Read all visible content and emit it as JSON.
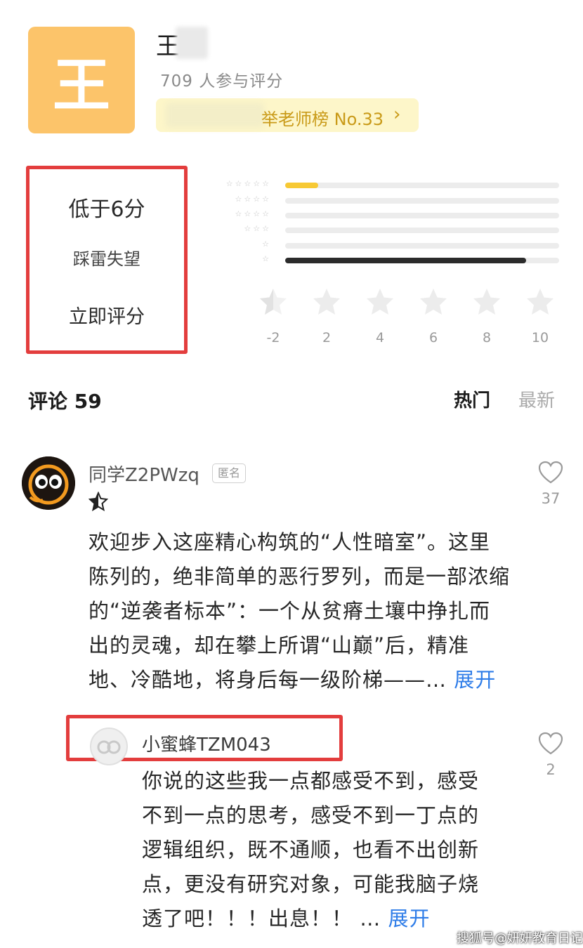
{
  "teacher": {
    "avatar_char": "王",
    "name": "王",
    "participants": "709 人参与评分",
    "rank_text": "举老师榜 No.33",
    "rank_arrow": "›"
  },
  "rating_box": {
    "score": "低于6分",
    "description": "踩雷失望",
    "action": "立即评分"
  },
  "distribution": {
    "rows": [
      {
        "stars": "☆☆☆☆☆",
        "fraction": 0.12,
        "color": "#f7c934"
      },
      {
        "stars": "☆☆☆☆",
        "fraction": 0.0,
        "color": "#333333"
      },
      {
        "stars": "☆☆☆☆",
        "fraction": 0.0,
        "color": "#333333"
      },
      {
        "stars": "☆☆☆",
        "fraction": 0.0,
        "color": "#333333"
      },
      {
        "stars": "☆",
        "fraction": 0.0,
        "color": "#333333"
      },
      {
        "stars": "☆",
        "fraction": 0.88,
        "color": "#2b2b2b"
      }
    ],
    "scale": [
      "-2",
      "2",
      "4",
      "6",
      "8",
      "10"
    ]
  },
  "comments_header": {
    "title": "评论 59",
    "tab_hot": "热门",
    "tab_new": "最新"
  },
  "comment": {
    "username": "同学Z2PWzq",
    "badge": "匿名",
    "body": "欢迎步入这座精心构筑的“人性暗室”。这里陈列的，绝非简单的恶行罗列，而是一部浓缩的“逆袭者标本”：一个从贫瘠土壤中挣扎而出的灵魂，却在攀上所谓“山巅”后，精准地、冷酷地，将身后每一级阶梯——…",
    "expand": "展开",
    "likes": "37"
  },
  "reply": {
    "username": "小蜜蜂TZM043",
    "body": "你说的这些我一点都感受不到，感受不到一点的思考，感受不到一丁点的逻辑组织，既不通顺，也看不出创新点，更没有研究对象，可能我脑子烧透了吧！！！出息！！ …",
    "expand": "展开",
    "likes": "2"
  },
  "watermark": "搜狐号@妍妍教育日记",
  "colors": {
    "highlight_border": "#e33d3d",
    "avatar_bg": "#fcc46a",
    "rank_text": "#c99a18",
    "link": "#2f7de8"
  }
}
